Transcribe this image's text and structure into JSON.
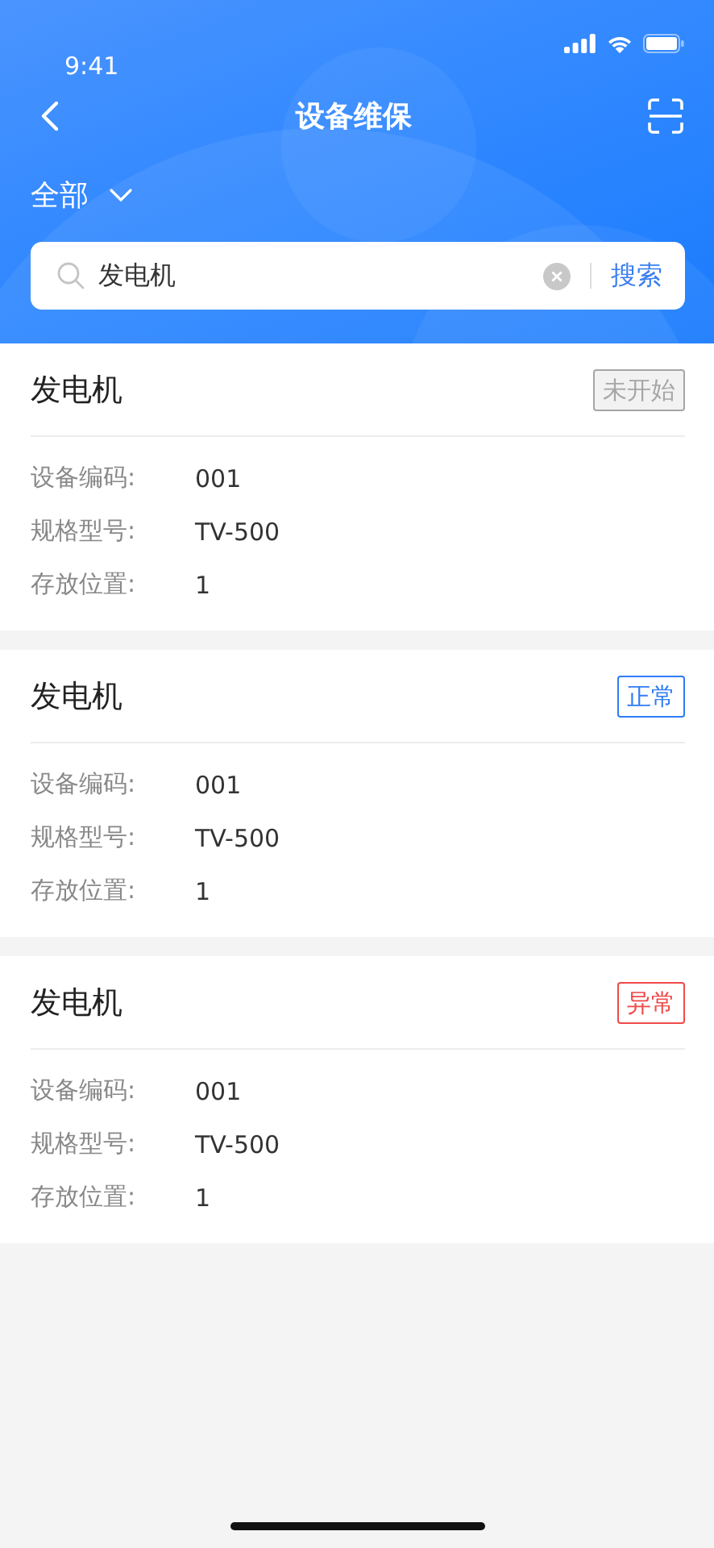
{
  "status_bar": {
    "time": "9:41"
  },
  "nav": {
    "title": "设备维保"
  },
  "filter": {
    "label": "全部"
  },
  "search": {
    "value": "发电机",
    "button": "搜索"
  },
  "items": [
    {
      "name": "发电机",
      "status": {
        "label": "未开始",
        "kind": "pending",
        "color": "#a6a6a6"
      },
      "fields": [
        {
          "label": "设备编码:",
          "value": "001"
        },
        {
          "label": "规格型号:",
          "value": "TV-500"
        },
        {
          "label": "存放位置:",
          "value": "1"
        }
      ]
    },
    {
      "name": "发电机",
      "status": {
        "label": "正常",
        "kind": "normal",
        "color": "#2f7cf6"
      },
      "fields": [
        {
          "label": "设备编码:",
          "value": "001"
        },
        {
          "label": "规格型号:",
          "value": "TV-500"
        },
        {
          "label": "存放位置:",
          "value": "1"
        }
      ]
    },
    {
      "name": "发电机",
      "status": {
        "label": "异常",
        "kind": "abnormal",
        "color": "#f04a4a"
      },
      "fields": [
        {
          "label": "设备编码:",
          "value": "001"
        },
        {
          "label": "规格型号:",
          "value": "TV-500"
        },
        {
          "label": "存放位置:",
          "value": "1"
        }
      ]
    }
  ]
}
